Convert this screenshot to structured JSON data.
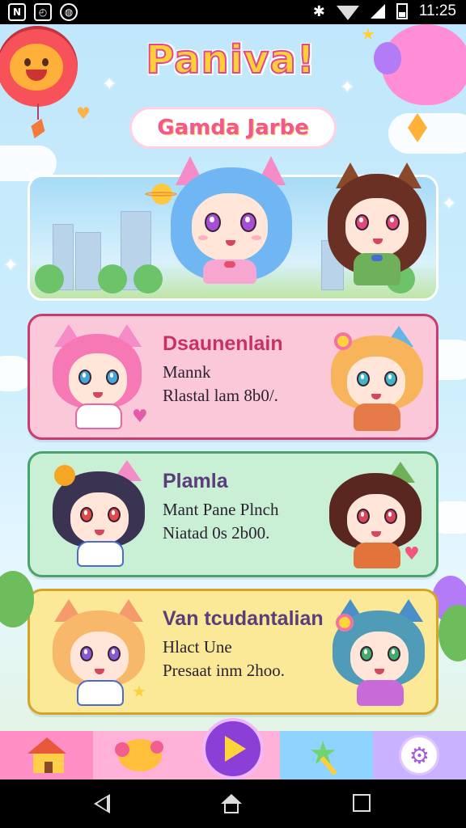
{
  "status_bar": {
    "time": "11:25",
    "left_icons": [
      "nfc-icon",
      "app-notification-icon",
      "security-icon"
    ],
    "right_icons": [
      "bluetooth-icon",
      "wifi-icon",
      "signal-icon",
      "battery-icon"
    ]
  },
  "header": {
    "title": "Paniva!",
    "subtitle": "Gamda Jarbe"
  },
  "levels": [
    {
      "name": "Dsaunenlain",
      "line1": "Mannk",
      "line2": "Rlastal lam 8b0/.",
      "theme": "pink",
      "accent": "#c93c6e"
    },
    {
      "name": "Plamla",
      "line1": "Mant Pane Plnch",
      "line2": "Niatad 0s 2b00.",
      "theme": "green",
      "accent": "#4aa36a"
    },
    {
      "name": "Van tcudantalian",
      "line1": "Hlact Une",
      "line2": "Presaat inm 2hoo.",
      "theme": "yellow",
      "accent": "#d4a429"
    }
  ],
  "bottom_nav": {
    "items": [
      "house-icon",
      "pet-icon",
      "play-icon",
      "magic-wand-icon",
      "settings-icon"
    ]
  },
  "colors": {
    "title_fill": "#ffcf3a",
    "title_outline": "#e0478c",
    "play_button": "#8b3fd6"
  }
}
